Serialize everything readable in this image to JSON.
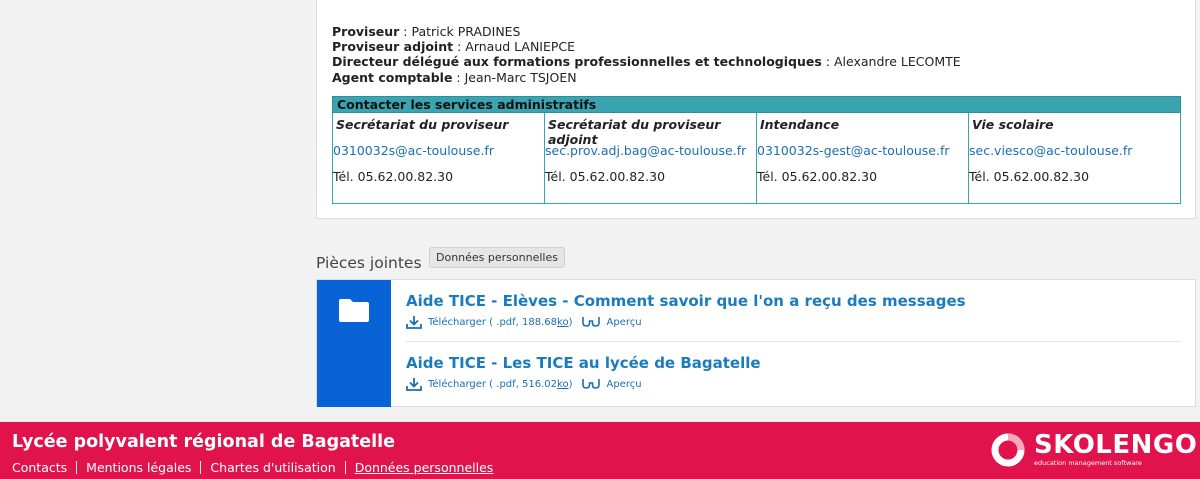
{
  "staff": [
    {
      "role": "Proviseur",
      "name": "Patrick PRADINES"
    },
    {
      "role": "Proviseur adjoint",
      "name": "Arnaud LANIEPCE"
    },
    {
      "role": "Directeur délégué aux formations professionnelles et technologiques",
      "name": "Alexandre LECOMTE"
    },
    {
      "role": "Agent comptable",
      "name": "Jean-Marc TSJOEN"
    }
  ],
  "contacts": {
    "header": "Contacter les services administratifs",
    "services": [
      {
        "title": "Secrétariat du proviseur",
        "email": "0310032s@ac-toulouse.fr",
        "tel": "Tél. 05.62.00.82.30"
      },
      {
        "title": "Secrétariat du proviseur adjoint",
        "email": "sec.prov.adj.bag@ac-toulouse.fr",
        "tel": "Tél. 05.62.00.82.30"
      },
      {
        "title": "Intendance",
        "email": "0310032s-gest@ac-toulouse.fr",
        "tel": "Tél. 05.62.00.82.30"
      },
      {
        "title": "Vie scolaire",
        "email": "sec.viesco@ac-toulouse.fr",
        "tel": "Tél. 05.62.00.82.30"
      }
    ]
  },
  "attachments": {
    "section_title": "Pièces jointes",
    "tooltip": "Données personnelles",
    "files": [
      {
        "title": "Aide TICE - Elèves - Comment savoir que l'on a reçu des messages",
        "download_prefix": "Télécharger ( .pdf, 188.68 ",
        "download_unit": "ko",
        "download_suffix": " )",
        "preview": "Aperçu"
      },
      {
        "title": "Aide TICE - Les TICE au lycée de Bagatelle",
        "download_prefix": "Télécharger ( .pdf, 516.02 ",
        "download_unit": "ko",
        "download_suffix": " )",
        "preview": "Aperçu"
      }
    ]
  },
  "footer": {
    "school": "Lycée polyvalent régional de Bagatelle",
    "links": [
      "Contacts",
      "Mentions légales",
      "Chartes d'utilisation",
      "Données personnelles"
    ],
    "brand": "SKOLENGO",
    "brand_sub": "education management software"
  },
  "colors": {
    "accent": "#e0134c",
    "table_header": "#3aa5b0",
    "attach_blue": "#0a63d6",
    "link": "#1a7bbf"
  }
}
